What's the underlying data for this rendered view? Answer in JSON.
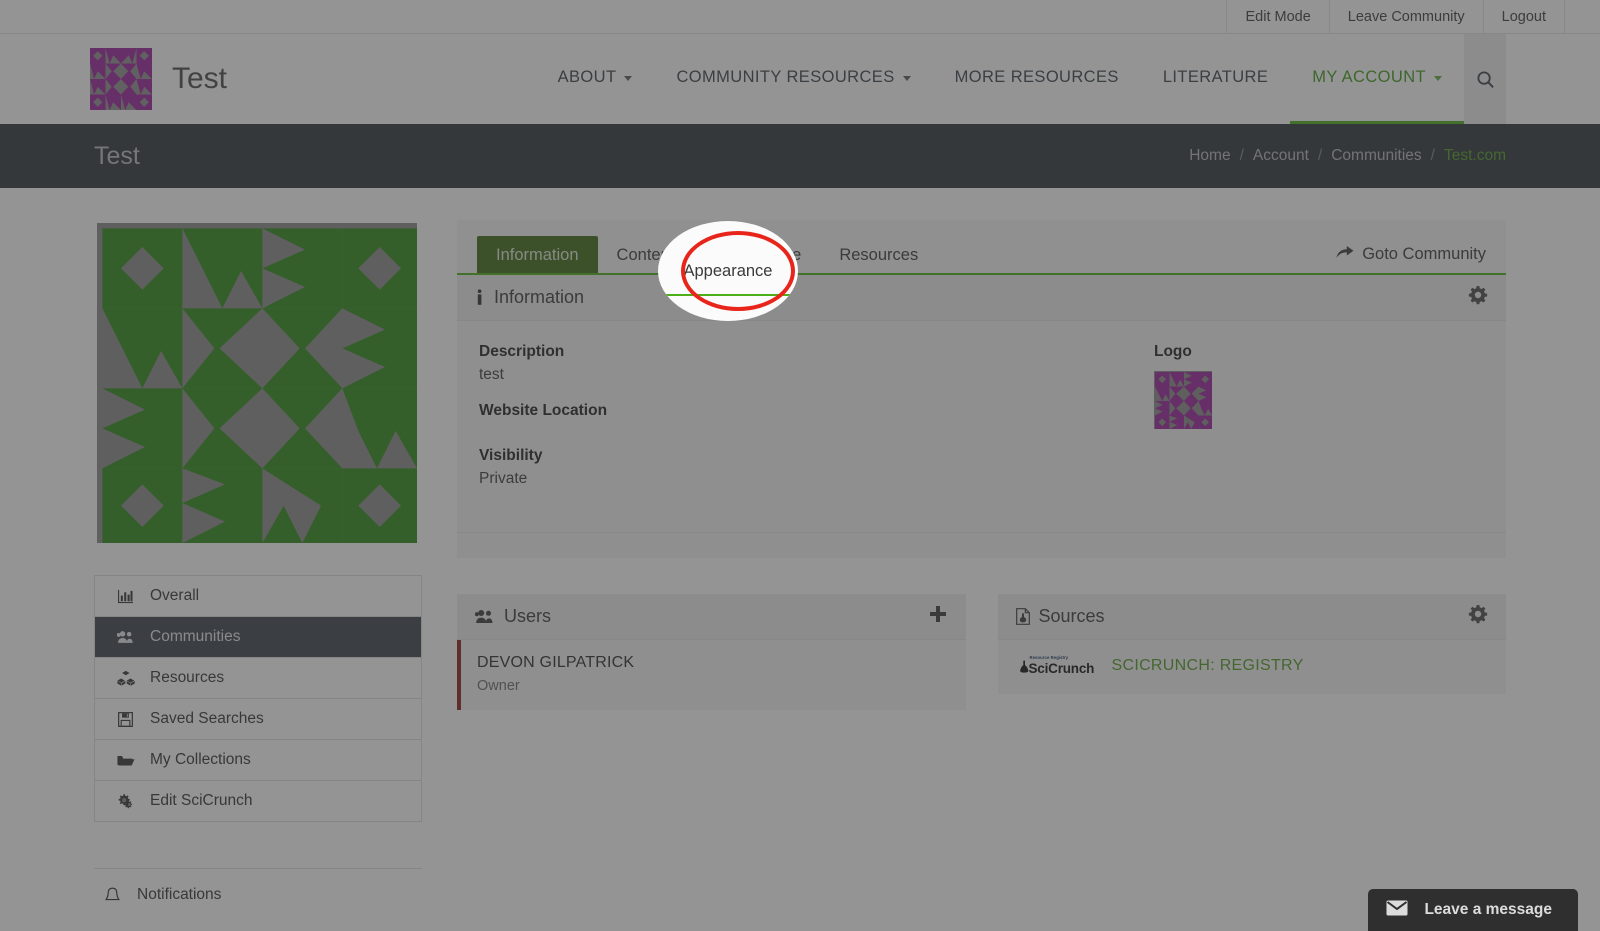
{
  "utility_bar": {
    "links": [
      "Edit Mode",
      "Leave Community",
      "Logout"
    ]
  },
  "masthead": {
    "brand_name": "Test",
    "brand_logo_icon": "identicon-purple",
    "nav": [
      {
        "label": "ABOUT",
        "has_caret": true,
        "active": false
      },
      {
        "label": "COMMUNITY RESOURCES",
        "has_caret": true,
        "active": false
      },
      {
        "label": "MORE RESOURCES",
        "has_caret": false,
        "active": false
      },
      {
        "label": "LITERATURE",
        "has_caret": false,
        "active": false
      },
      {
        "label": "MY ACCOUNT",
        "has_caret": true,
        "active": true
      }
    ],
    "search_icon": "search-icon"
  },
  "page_header": {
    "title": "Test",
    "breadcrumb": [
      "Home",
      "Account",
      "Communities",
      "Test.com"
    ],
    "breadcrumb_separator": "/",
    "current_crumb": "Test.com"
  },
  "sidebar": {
    "identicon_icon": "identicon-green",
    "items": [
      {
        "label": "Overall",
        "icon": "bar-chart-icon",
        "active": false
      },
      {
        "label": "Communities",
        "icon": "users-icon",
        "active": true
      },
      {
        "label": "Resources",
        "icon": "cubes-icon",
        "active": false
      },
      {
        "label": "Saved Searches",
        "icon": "floppy-save-icon",
        "active": false
      },
      {
        "label": "My Collections",
        "icon": "folder-open-icon",
        "active": false
      },
      {
        "label": "Edit SciCrunch",
        "icon": "cogs-icon",
        "active": false
      }
    ],
    "secondary_items": [
      {
        "label": "Notifications",
        "icon": "bell-icon"
      }
    ]
  },
  "content": {
    "tabs": [
      {
        "label": "Information",
        "active": true
      },
      {
        "label": "Content",
        "active": false
      },
      {
        "label": "Appearance",
        "active": false,
        "highlighted": true
      },
      {
        "label": "Resources",
        "active": false
      }
    ],
    "goto_community": {
      "label": "Goto Community",
      "icon": "share-arrow-icon"
    },
    "information_panel": {
      "title": "Information",
      "icon": "info-icon",
      "gear_icon": "gear-icon",
      "fields": [
        {
          "label": "Description",
          "value": "test"
        },
        {
          "label": "Website Location",
          "value": ""
        },
        {
          "label": "Visibility",
          "value": "Private"
        }
      ],
      "logo_label": "Logo",
      "logo_icon": "identicon-purple"
    },
    "users_panel": {
      "title": "Users",
      "icon": "users-icon",
      "add_icon": "plus-icon",
      "rows": [
        {
          "name": "DEVON GILPATRICK",
          "role": "Owner"
        }
      ]
    },
    "sources_panel": {
      "title": "Sources",
      "icon": "file-flask-icon",
      "gear_icon": "gear-icon",
      "rows": [
        {
          "logo_top": "Resource Registry",
          "logo_word": "SciCrunch",
          "name": "SCICRUNCH: REGISTRY"
        }
      ]
    }
  },
  "chat_widget": {
    "label": "Leave a message",
    "icon": "envelope-icon"
  },
  "spotlight": {
    "target_label": "Appearance",
    "ring_color": "#e8251b",
    "scrim_color": "rgba(60,60,60,0.55)"
  },
  "colors": {
    "accent_green": "#4caf17",
    "tab_active_green": "#3d6b16",
    "link_green": "#4f9b23",
    "dark_header": "#2e3338",
    "sidebar_active": "#3b4149",
    "user_accent_red": "#8f1d1d",
    "logo_purple": "#9c1f9c"
  }
}
